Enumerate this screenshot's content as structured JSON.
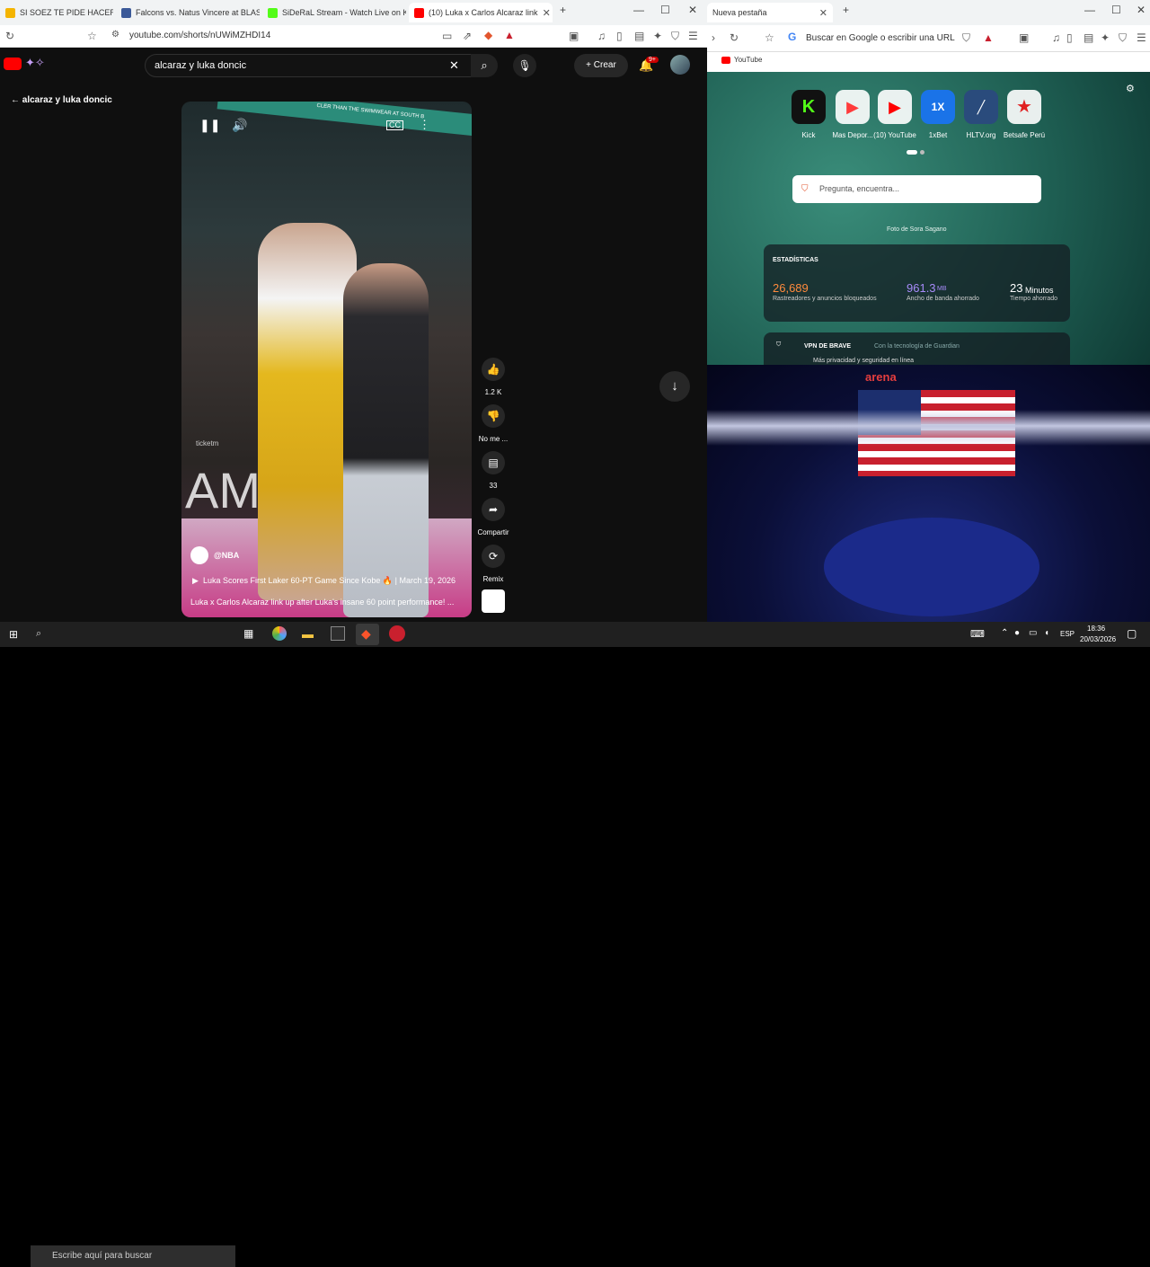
{
  "left_browser": {
    "tabs": [
      {
        "label": "SI SOEZ TE PIDE HACER NOV",
        "color": "#f4b400"
      },
      {
        "label": "Falcons vs. Natus Vincere at BLAST O",
        "color": "#3b5998"
      },
      {
        "label": "SiDeRaL Stream - Watch Live on Kick",
        "color": "#53fc18"
      },
      {
        "label": "(10) Luka x Carlos Alcaraz link",
        "color": "#ff0000"
      }
    ],
    "url": "youtube.com/shorts/nUWiMZHDI14",
    "search_value": "alcaraz y luka doncic",
    "create_label": "Crear",
    "notif_count": "9+",
    "back_label": "alcaraz y luka doncic",
    "channel": "@NBA",
    "video_link": "Luka Scores First Laker 60-PT Game Since Kobe 🔥 | March 19, 2026",
    "video_title": "Luka x Carlos Alcaraz link up after Luka's insane 60 point performance! ...",
    "like_count": "1.2 K",
    "dislike_label": "No me ...",
    "comment_count": "33",
    "share_label": "Compartir",
    "remix_label": "Remix",
    "overlay_text": "AM",
    "banner_text": "CLER THAN THE SWIMWEAR AT SOUTH B",
    "ticket_text": "ticketm"
  },
  "right_browser": {
    "tab_label": "Nueva pestaña",
    "address_placeholder": "Buscar en Google o escribir una URL",
    "bookmark_label": "YouTube",
    "shortcuts": [
      {
        "label": "Kick",
        "color": "#53fc18"
      },
      {
        "label": "Mas Depor...",
        "color": "#ff3b3b"
      },
      {
        "label": "(10) YouTube",
        "color": "#ff0000"
      },
      {
        "label": "1xBet",
        "color": "#1a73e8"
      },
      {
        "label": "HLTV.org",
        "color": "#2a4b7c"
      },
      {
        "label": "Betsafe Perú",
        "color": "#e02020"
      }
    ],
    "search_placeholder": "Pregunta, encuentra...",
    "photo_credit": "Foto de Sora Sagano",
    "stats_title": "ESTADÍSTICAS",
    "stats": [
      {
        "value": "26,689",
        "unit": "",
        "label": "Rastreadores y anuncios bloqueados",
        "color": "#ff8a3d"
      },
      {
        "value": "961.3",
        "unit": "MB",
        "label": "Ancho de banda ahorrado",
        "color": "#a78bfa"
      },
      {
        "value": "23",
        "unit": "Minutos",
        "label": "Tiempo ahorrado",
        "color": "#ffffff"
      }
    ],
    "vpn_title": "VPN DE BRAVE",
    "vpn_powered": "Con la tecnología de Guardian",
    "vpn_sub": "Más privacidad y seguridad en línea",
    "arena_sign": "arena"
  },
  "taskbar": {
    "search_placeholder": "Escribe aquí para buscar",
    "lang": "ESP",
    "time": "18:36",
    "date": "20/03/2026"
  }
}
